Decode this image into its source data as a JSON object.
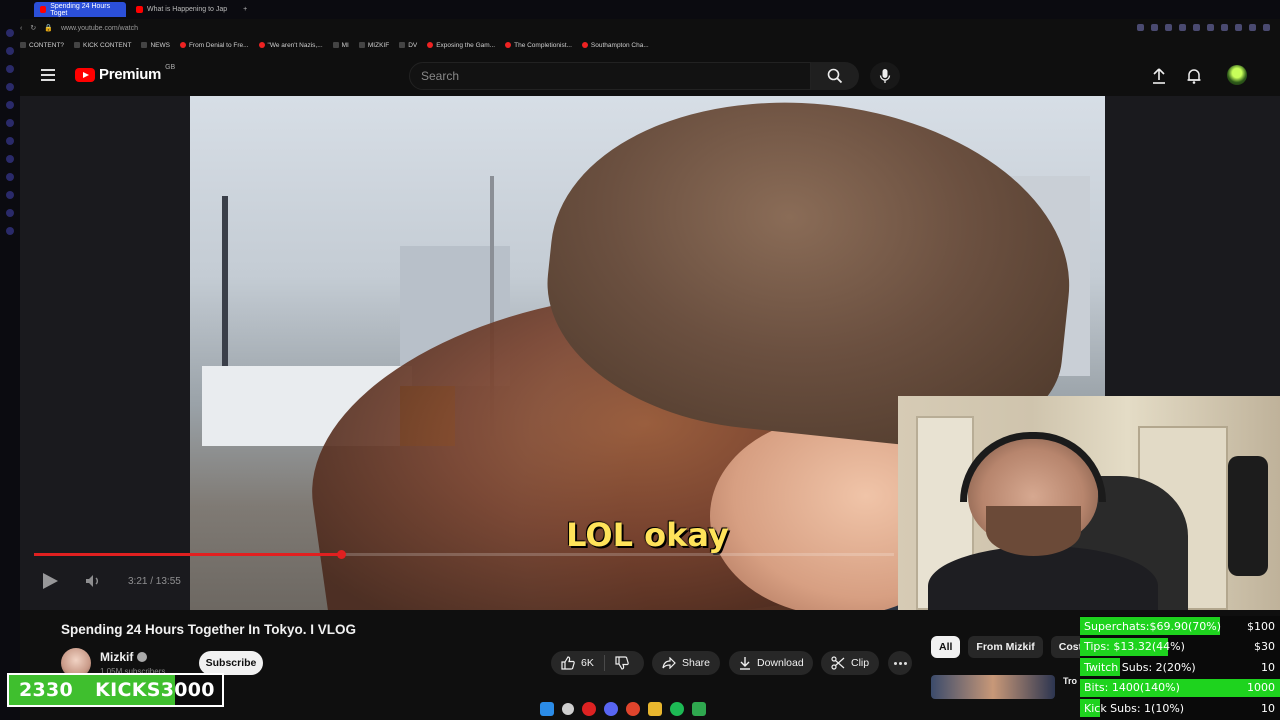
{
  "browser": {
    "tabs": [
      {
        "label": "Spending 24 Hours Toget"
      },
      {
        "label": "What is Happening to Jap"
      }
    ],
    "url": "www.youtube.com/watch",
    "bookmarks": [
      {
        "label": "CONTENT?"
      },
      {
        "label": "KICK CONTENT"
      },
      {
        "label": "NEWS"
      },
      {
        "label": "From Denial to Fre..."
      },
      {
        "label": "\"We aren't Nazis,..."
      },
      {
        "label": "MI"
      },
      {
        "label": "MIZKIF"
      },
      {
        "label": "DV"
      },
      {
        "label": "Exposing the Gam..."
      },
      {
        "label": "The Completionist..."
      },
      {
        "label": "Southampton Cha..."
      }
    ]
  },
  "header": {
    "logo_text": "Premium",
    "region": "GB",
    "search_placeholder": "Search"
  },
  "player": {
    "caption": "LOL okay",
    "time": "3:21 / 13:55",
    "progress": 0.357
  },
  "video": {
    "title": "Spending 24 Hours Together In Tokyo. I VLOG",
    "channel": "Mizkif",
    "subscribers": "1.05M subscribers",
    "subscribe_label": "Subscribe",
    "likes": "6K",
    "share_label": "Share",
    "download_label": "Download",
    "clip_label": "Clip"
  },
  "related": {
    "chips": [
      "All",
      "From Mizkif",
      "Costi"
    ],
    "first_title": "Tro"
  },
  "kicks_overlay": {
    "current": "2330",
    "label": "KICKS",
    "goal": "3000",
    "progress": 0.777
  },
  "stats_overlay": {
    "rows": [
      {
        "label": "Superchats:$69.90(70%)",
        "goal": "$100",
        "fill": 0.7
      },
      {
        "label": "Tips:      $13.32(44%)",
        "goal": "$30",
        "fill": 0.44
      },
      {
        "label": "Twitch Subs: 2(20%)",
        "goal": "10",
        "fill": 0.2
      },
      {
        "label": "Bits:      1400(140%)",
        "goal": "1000",
        "fill": 1.0
      },
      {
        "label": "Kick Subs:  1(10%)",
        "goal": "10",
        "fill": 0.1
      }
    ]
  },
  "colors": {
    "yt_red": "#ff0000",
    "progress_red": "#e02020",
    "caption_yellow": "#ffe35a",
    "goal_green": "#1ed31e",
    "kicks_green": "#3fbf2e"
  }
}
